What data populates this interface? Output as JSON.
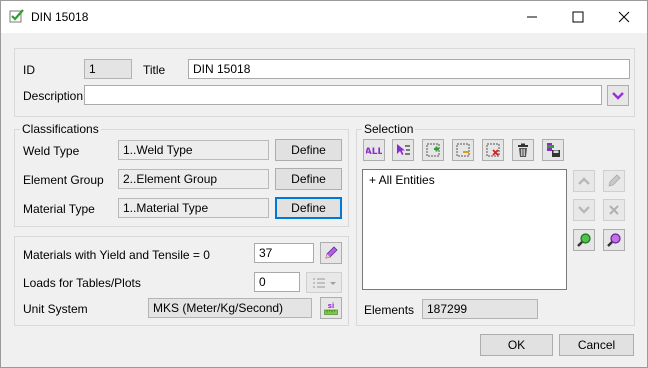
{
  "window": {
    "title": "DIN 15018",
    "minimize_icon": "minimize-icon",
    "maximize_icon": "maximize-icon",
    "close_icon": "close-icon"
  },
  "header": {
    "id_label": "ID",
    "id_value": "1",
    "title_label": "Title",
    "title_value": "DIN 15018",
    "description_label": "Description",
    "description_value": ""
  },
  "classifications": {
    "group_label": "Classifications",
    "rows": [
      {
        "label": "Weld Type",
        "value": "1..Weld Type",
        "button": "Define"
      },
      {
        "label": "Element Group",
        "value": "2..Element Group",
        "button": "Define"
      },
      {
        "label": "Material Type",
        "value": "1..Material Type",
        "button": "Define"
      }
    ]
  },
  "settings": {
    "materials_label": "Materials with Yield and Tensile = 0",
    "materials_value": "37",
    "loads_label": "Loads for Tables/Plots",
    "loads_value": "0",
    "unit_label": "Unit System",
    "unit_value": "MKS (Meter/Kg/Second)",
    "unit_icon_text": "si"
  },
  "selection": {
    "group_label": "Selection",
    "all_button": "ALL",
    "list_items": [
      "+ All Entities"
    ],
    "elements_label": "Elements",
    "elements_value": "187299"
  },
  "footer": {
    "ok_label": "OK",
    "cancel_label": "Cancel"
  },
  "colors": {
    "accent": "#0078d7",
    "purple": "#9b30d9",
    "green_check": "#2e9e2e"
  }
}
